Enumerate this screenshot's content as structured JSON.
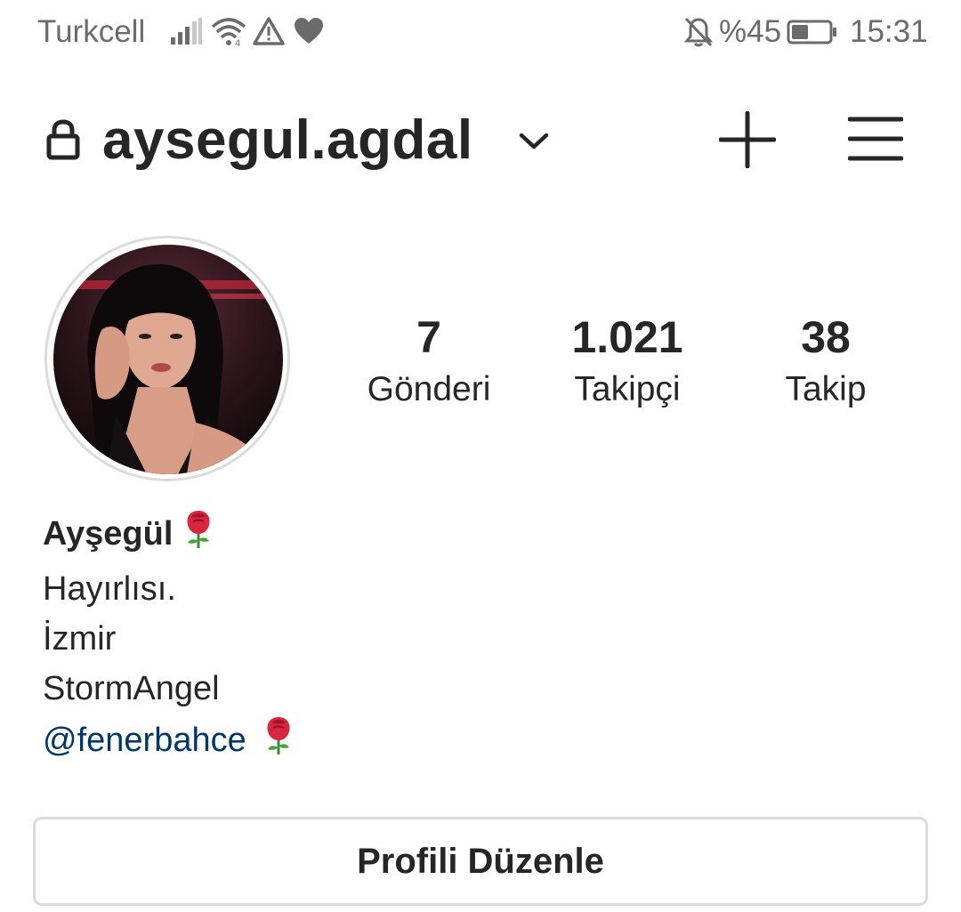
{
  "status_bar": {
    "carrier": "Turkcell",
    "battery_text": "%45",
    "battery_level": 0.45,
    "time": "15:31",
    "icons": [
      "signal-icon",
      "wifi-icon",
      "warning-icon",
      "heart-icon",
      "bell-off-icon",
      "battery-icon"
    ]
  },
  "header": {
    "username": "aysegul.agdal",
    "icons": [
      "lock-icon",
      "chevron-down-icon",
      "plus-icon",
      "menu-icon"
    ]
  },
  "stats": {
    "posts": {
      "value": "7",
      "label": "Gönderi"
    },
    "followers": {
      "value": "1.021",
      "label": "Takipçi"
    },
    "following": {
      "value": "38",
      "label": "Takip"
    }
  },
  "bio": {
    "name": "Ayşegül",
    "lines": [
      "Hayırlısı.",
      "İzmir",
      "StormAngel"
    ],
    "link": "@fenerbahce",
    "emoji_icon": "rose-icon"
  },
  "edit_profile_label": "Profili Düzenle",
  "colors": {
    "text": "#262626",
    "status_text": "#6b6b6b",
    "link": "#00376b",
    "border": "#dbdbdb"
  }
}
